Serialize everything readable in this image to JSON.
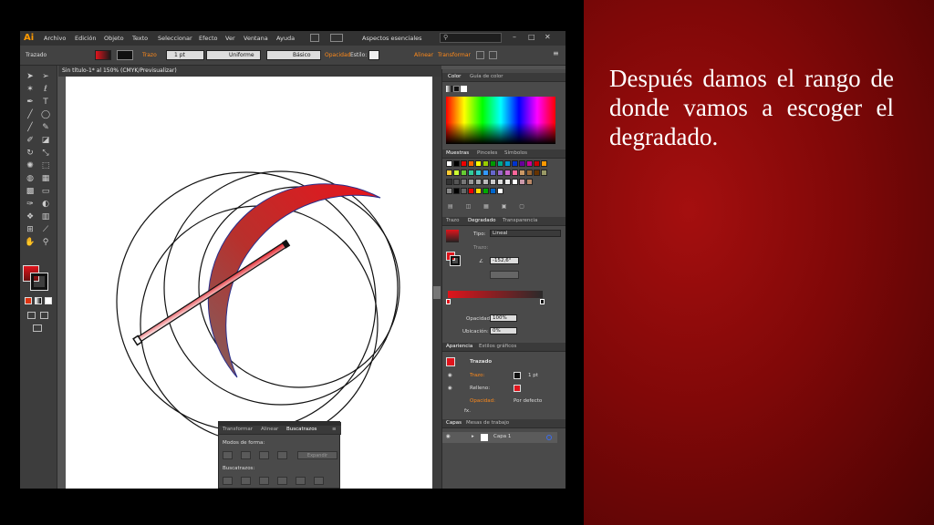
{
  "caption": "Después damos el rango de donde vamos a escoger el degradado.",
  "app": {
    "logo": "Ai",
    "menu": [
      "Archivo",
      "Edición",
      "Objeto",
      "Texto",
      "Seleccionar",
      "Efecto",
      "Ver",
      "Ventana",
      "Ayuda"
    ],
    "workspace": "Aspectos esenciales",
    "search_placeholder": ""
  },
  "control_bar": {
    "object_type": "Trazado",
    "stroke_label": "Trazo",
    "stroke_width": "1 pt",
    "stroke_profile": "Uniforme",
    "brush": "Básico",
    "opacity_label": "Opacidad",
    "style_label": "Estilo:",
    "align_label": "Alinear",
    "transform_label": "Transformar"
  },
  "document_tab": "Sin título-1* al 150% (CMYK/Previsualizar)",
  "color_panel": {
    "tabs": [
      "Color",
      "Guía de color"
    ]
  },
  "swatches_panel": {
    "tabs": [
      "Muestras",
      "Pinceles",
      "Símbolos"
    ]
  },
  "gradient_panel": {
    "tabs": [
      "Trazo",
      "Degradado",
      "Transparencia"
    ],
    "type_label": "Tipo:",
    "type_value": "Lineal",
    "stroke_label": "Trazo:",
    "angle_value": "-152,6°",
    "opacity_label": "Opacidad:",
    "opacity_value": "100%",
    "location_label": "Ubicación:",
    "location_value": "0%"
  },
  "appearance_panel": {
    "tabs": [
      "Apariencia",
      "Estilos gráficos"
    ],
    "title": "Trazado",
    "stroke_label": "Trazo:",
    "stroke_value": "1 pt",
    "fill_label": "Relleno:",
    "opacity_label": "Opacidad:",
    "opacity_value": "Por defecto",
    "fx_label": "fx."
  },
  "layers_panel": {
    "tabs": [
      "Capas",
      "Mesas de trabajo"
    ],
    "layer_name": "Capa 1"
  },
  "pathfinder_panel": {
    "tabs": [
      "Transformar",
      "Alinear",
      "Buscatrazos"
    ],
    "modes_label": "Modos de forma:",
    "expand_label": "Expandir",
    "pathfinders_label": "Buscatrazos:"
  },
  "colors": {
    "accent_red": "#e0141c",
    "gradient_dark": "#1a1a1a",
    "slide_red": "#a50f0f"
  }
}
